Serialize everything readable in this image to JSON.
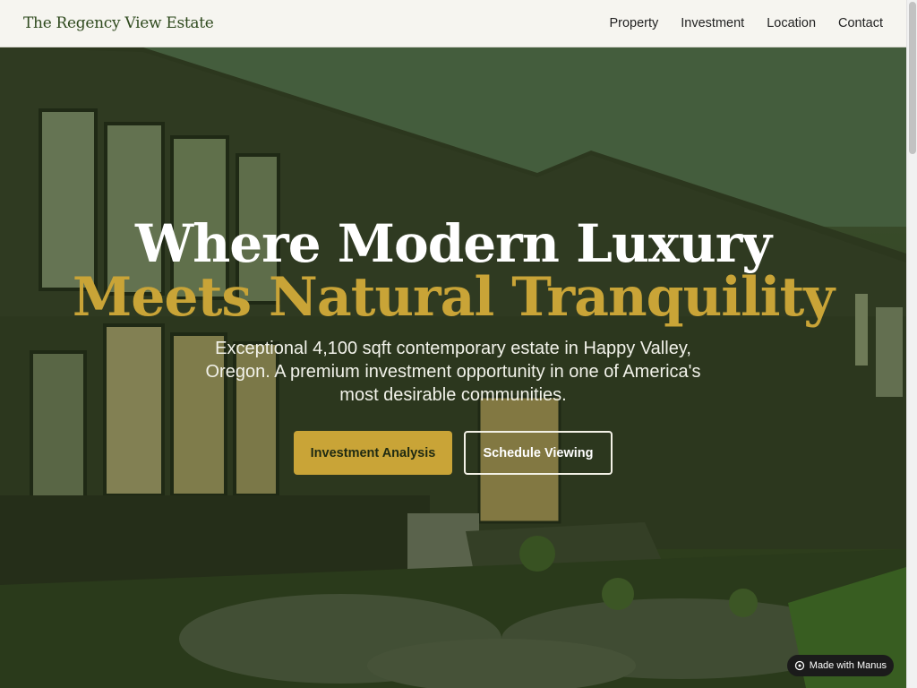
{
  "header": {
    "brand": "The Regency View Estate",
    "nav": [
      "Property",
      "Investment",
      "Location",
      "Contact"
    ]
  },
  "hero": {
    "title_line1": "Where Modern Luxury",
    "title_line2": "Meets Natural Tranquility",
    "subtitle": "Exceptional 4,100 sqft contemporary estate in Happy Valley, Oregon. A premium investment opportunity in one of America's most desirable communities.",
    "primary_button": "Investment Analysis",
    "secondary_button": "Schedule Viewing"
  },
  "badge": {
    "label": "Made with Manus",
    "icon": "manus-logo-icon"
  },
  "colors": {
    "accent_gold": "#c9a437",
    "brand_green": "#2f4a1e"
  }
}
